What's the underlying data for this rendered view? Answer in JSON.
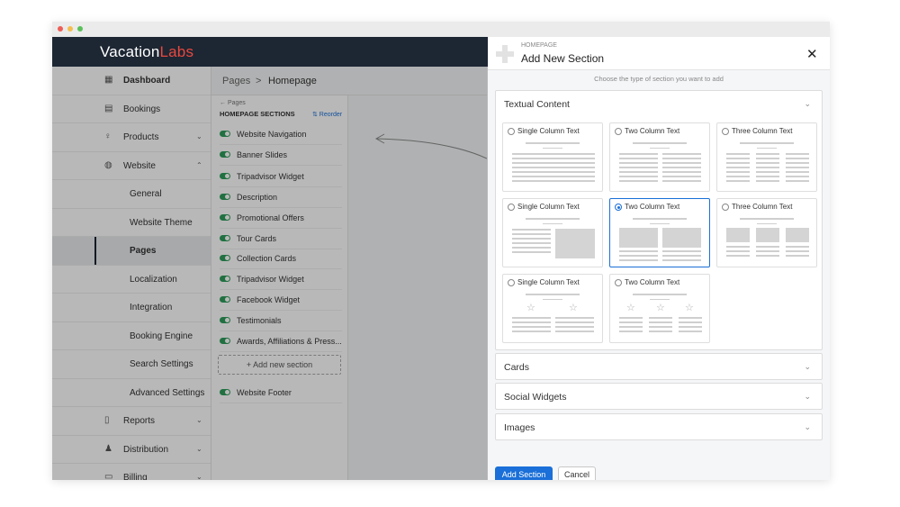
{
  "window_dots": [
    "#ee5e56",
    "#f4be4f",
    "#5ac05a"
  ],
  "brand": {
    "part1": "Vacation",
    "part2": "Labs",
    "accent": "#e8483f"
  },
  "sidebar": {
    "items": [
      {
        "label": "Dashboard",
        "icon": "calendar-icon",
        "glyph": "▦"
      },
      {
        "label": "Bookings",
        "icon": "list-icon",
        "glyph": "▤"
      },
      {
        "label": "Products",
        "icon": "bulb-icon",
        "glyph": "♀",
        "chevron": "⌄"
      },
      {
        "label": "Website",
        "icon": "globe-icon",
        "glyph": "◍",
        "chevron": "⌃"
      },
      {
        "label": "General"
      },
      {
        "label": "Website Theme"
      },
      {
        "label": "Pages"
      },
      {
        "label": "Localization"
      },
      {
        "label": "Integration"
      },
      {
        "label": "Booking Engine"
      },
      {
        "label": "Search Settings"
      },
      {
        "label": "Advanced Settings"
      },
      {
        "label": "Reports",
        "icon": "file-icon",
        "glyph": "▯",
        "chevron": "⌄"
      },
      {
        "label": "Distribution",
        "icon": "users-icon",
        "glyph": "♟",
        "chevron": "⌄"
      },
      {
        "label": "Billing",
        "icon": "billing-icon",
        "glyph": "▭",
        "chevron": "⌄"
      }
    ]
  },
  "breadcrumb": {
    "parent": "Pages",
    "separator": ">",
    "current": "Homepage"
  },
  "pages_panel": {
    "back_label": "← Pages",
    "section_title": "HOMEPAGE SECTIONS",
    "reorder_label": "⇅ Reorder",
    "sections": [
      "Website Navigation",
      "Banner Slides",
      "Tripadvisor Widget",
      "Description",
      "Promotional Offers",
      "Tour Cards",
      "Collection Cards",
      "Tripadvisor Widget",
      "Facebook Widget",
      "Testimonials",
      "Awards, Affiliations & Press..."
    ],
    "add_new_label": "+ Add new section",
    "footer_section": "Website Footer",
    "toggle_color": "#2e9c5a"
  },
  "modal": {
    "eyebrow": "HOMEPAGE",
    "title": "Add New Section",
    "close_glyph": "✕",
    "instruction": "Choose the type of section you want to add",
    "accordions": [
      {
        "title": "Textual Content",
        "chevron": "⌄",
        "expanded": true
      },
      {
        "title": "Cards",
        "chevron": "⌄"
      },
      {
        "title": "Social Widgets",
        "chevron": "⌄"
      },
      {
        "title": "Images",
        "chevron": "⌄"
      }
    ],
    "options": [
      {
        "label": "Single Column Text",
        "selected": false
      },
      {
        "label": "Two Column Text",
        "selected": false
      },
      {
        "label": "Three Column Text",
        "selected": false
      },
      {
        "label": "Single Column Text",
        "selected": false
      },
      {
        "label": "Two Column Text",
        "selected": true
      },
      {
        "label": "Three Column Text",
        "selected": false
      },
      {
        "label": "Single Column Text",
        "selected": false
      },
      {
        "label": "Two Column Text",
        "selected": false
      }
    ],
    "add_button": "Add Section",
    "cancel_button": "Cancel",
    "primary_color": "#1a6fd8"
  }
}
